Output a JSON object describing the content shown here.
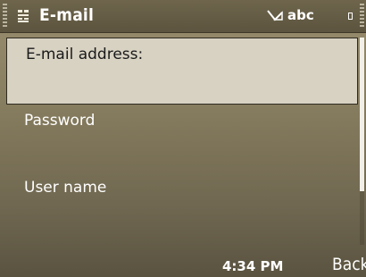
{
  "status_bar": {
    "app_icon": "email-app-icon",
    "title": "E-mail",
    "input_mode_icon": "pen-input-icon",
    "input_mode": "abc",
    "battery_icon": "battery-icon"
  },
  "form": {
    "fields": [
      {
        "label": "E-mail address:",
        "focused": true
      },
      {
        "label": "Password",
        "focused": false
      },
      {
        "label": "User name",
        "focused": false
      }
    ]
  },
  "softkeys": {
    "clock": "4:34 PM",
    "right": "Back"
  },
  "colors": {
    "focus_background": "#d8d2c3",
    "background": "#857b5e",
    "text_light": "#ffffff"
  }
}
